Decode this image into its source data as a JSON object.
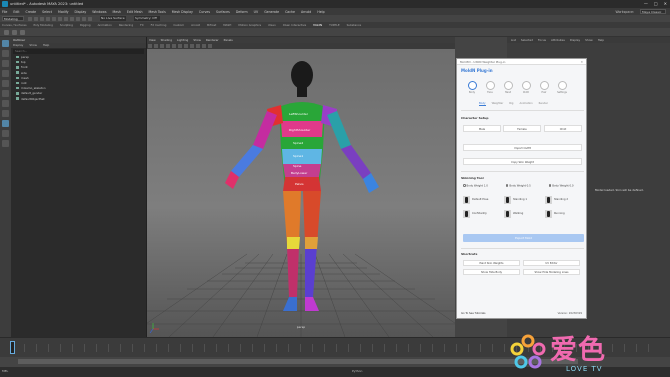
{
  "window": {
    "title": "untitled* - Autodesk MAYA 2023: untitled",
    "controls": [
      "—",
      "□",
      "✕"
    ]
  },
  "menubar": {
    "items": [
      "File",
      "Edit",
      "Create",
      "Select",
      "Modify",
      "Display",
      "Windows",
      "Mesh",
      "Edit Mesh",
      "Mesh Tools",
      "Mesh Display",
      "Curves",
      "Surfaces",
      "Deform",
      "UV",
      "Generate",
      "Cache",
      "Arnold",
      "Help"
    ],
    "workspace_label": "Workspace:",
    "workspace_value": "Maya Classic"
  },
  "statusline": {
    "mode": "Modeling",
    "field": "No Live Surface",
    "symmetry": "Symmetry: Off"
  },
  "shelf": {
    "tabs": [
      "Curves / Surfaces",
      "Poly Modeling",
      "Sculpting",
      "Rigging",
      "Animation",
      "Rendering",
      "FX",
      "FX Caching",
      "Custom",
      "Arnold",
      "Bifrost",
      "MASH",
      "Motion Graphics",
      "XGen",
      "XGen Interactive",
      "MoldN",
      "TURTLE",
      "Substance"
    ],
    "active_tab": "MoldN"
  },
  "outliner": {
    "title": "Outliner",
    "menu": [
      "Display",
      "Show",
      "Help"
    ],
    "search_placeholder": "Search...",
    "items": [
      "persp",
      "top",
      "front",
      "side",
      "mesh",
      "root",
      "mixamo_skeleton",
      "default_gender",
      "defaultObjectSet"
    ]
  },
  "viewport": {
    "menu": [
      "View",
      "Shading",
      "Lighting",
      "Show",
      "Renderer",
      "Panels"
    ],
    "camera": "persp",
    "body_labels": [
      "LeftShoulder",
      "RightShoulder",
      "Spine2",
      "Spine1",
      "Spine",
      "BellyLower",
      "Pelvis"
    ]
  },
  "rightpanel": {
    "tabs": [
      "List",
      "Selected",
      "Focus",
      "Attributes",
      "Display",
      "Show",
      "Help"
    ],
    "note": "Model loaded. Skin will be defined."
  },
  "plugin": {
    "window_title": "Mold3D - UXON Weighter Plug-in",
    "brand": "MoldN",
    "brand_suffix": "Plug-in",
    "modes": [
      {
        "label": "Body",
        "on": true
      },
      {
        "label": "Face",
        "on": false
      },
      {
        "label": "Hand",
        "on": false
      },
      {
        "label": "Cloth",
        "on": false
      },
      {
        "label": "Hair",
        "on": false
      },
      {
        "label": "Settings",
        "on": false
      }
    ],
    "tabs": [
      "Body",
      "Weighter",
      "Rig",
      "Animation",
      "Render"
    ],
    "active_tab": "Body",
    "character_setup": {
      "title": "Character Setup",
      "buttons": [
        "Male",
        "Female",
        "Child"
      ],
      "import_button": "Import Outfit",
      "copy_button": "Copy Skin Weight"
    },
    "skinning": {
      "title": "Skinning Tool",
      "radios": [
        "Body Weight 1.0",
        "Body Weight 0.5",
        "Body Weight 0.0"
      ],
      "options": [
        "Default Pose",
        "Standing 1",
        "Standing 2",
        "Confidently",
        "Walking",
        "Running"
      ],
      "export_button": "Export Mold"
    },
    "shortcuts": {
      "title": "Shortcuts",
      "buttons": [
        "Paint Skin Weights",
        "UV Editor",
        "Show Hide Body",
        "Show Hide Modeling Lines"
      ]
    },
    "footer": "Go To See Tutorials",
    "version": "Version: 20230329"
  },
  "timeline": {
    "start": "1",
    "end": "120"
  },
  "commandline": {
    "mel": "MEL",
    "python": "Python"
  },
  "watermark": {
    "text": "爱色",
    "subtitle": "LOVE TV"
  }
}
